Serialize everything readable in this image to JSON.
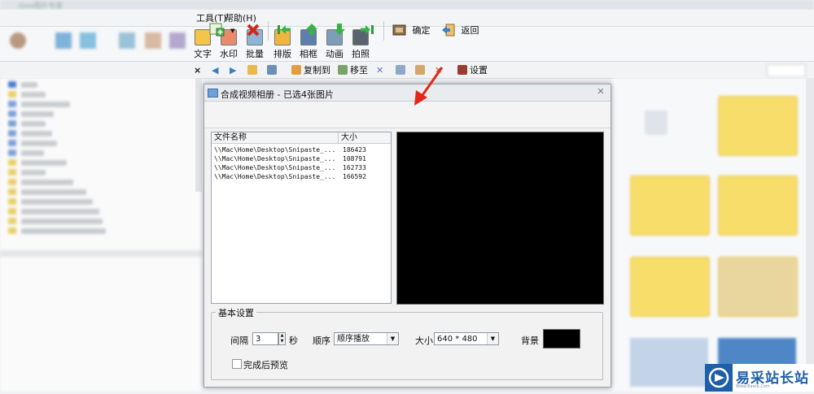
{
  "background_app": {
    "title": "iSee图片专家",
    "menu": [
      "工具(T)",
      "帮助(H)"
    ],
    "toolbar": [
      "文字",
      "水印",
      "批量",
      "排版",
      "相框",
      "动画",
      "拍照"
    ],
    "toolbar2": {
      "copy_to": "复制到",
      "move_to": "移至",
      "settings": "设置"
    }
  },
  "dialog": {
    "title": "合成视频相册 - 已选4张图片",
    "close_icon": "close-icon",
    "toolbar": {
      "confirm": "确定",
      "back": "返回"
    },
    "file_list": {
      "columns": [
        "文件名称",
        "大小"
      ],
      "rows": [
        {
          "name": "\\\\Mac\\Home\\Desktop\\Snipaste_...",
          "size": "186423"
        },
        {
          "name": "\\\\Mac\\Home\\Desktop\\Snipaste_...",
          "size": "108791"
        },
        {
          "name": "\\\\Mac\\Home\\Desktop\\Snipaste_...",
          "size": "162733"
        },
        {
          "name": "\\\\Mac\\Home\\Desktop\\Snipaste_...",
          "size": "166592"
        }
      ]
    },
    "settings": {
      "legend": "基本设置",
      "interval_label": "间隔",
      "interval_value": "3",
      "interval_unit": "秒",
      "order_label": "顺序",
      "order_value": "顺序播放",
      "size_label": "大小",
      "size_value": "640 * 480",
      "background_label": "背景",
      "background_color": "#000000",
      "preview_after_label": "完成后预览",
      "preview_after_checked": false
    }
  },
  "colors": {
    "accent_arrow": "#e3261b",
    "watermark_blue": "#1d5fa8"
  },
  "watermark": {
    "text": "易采站长站",
    "sub": "Www.Easck.Com"
  }
}
